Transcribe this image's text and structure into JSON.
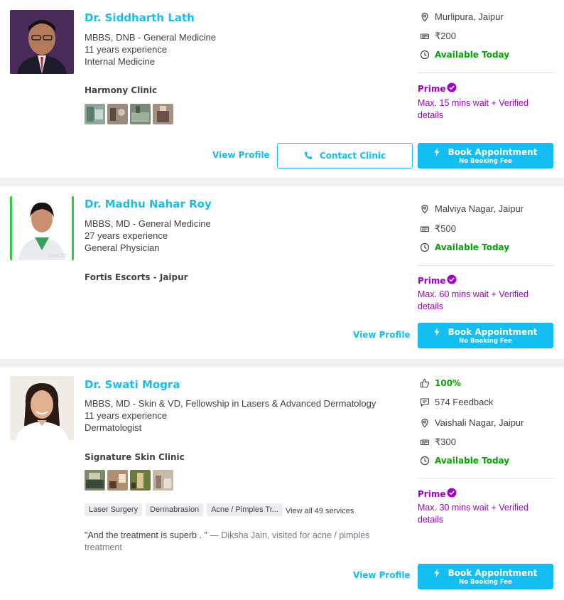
{
  "doctors": [
    {
      "name": "Dr. Siddharth Lath",
      "degree": "MBBS, DNB - General Medicine",
      "experience": "11 years experience",
      "specialty": "Internal Medicine",
      "clinic": "Harmony Clinic",
      "location": "Murlipura, Jaipur",
      "fee": "₹200",
      "availability": "Available Today",
      "prime_label": "Prime",
      "prime_note": "Max. 15 mins wait + Verified details",
      "view_profile": "View Profile",
      "contact_clinic": "Contact Clinic",
      "book": "Book Appointment",
      "book_sub": "No Booking Fee"
    },
    {
      "name": "Dr. Madhu Nahar Roy",
      "degree": "MBBS, MD - General Medicine",
      "experience": "27 years experience",
      "specialty": "General Physician",
      "clinic": "Fortis Escorts - Jaipur",
      "location": "Malviya Nagar, Jaipur",
      "fee": "₹500",
      "availability": "Available Today",
      "prime_label": "Prime",
      "prime_note": "Max. 60 mins wait + Verified details",
      "view_profile": "View Profile",
      "book": "Book Appointment",
      "book_sub": "No Booking Fee",
      "photo_watermark": "practo"
    },
    {
      "name": "Dr. Swati Mogra",
      "degree": "MBBS, MD - Skin & VD, Fellowship in Lasers & Advanced Dermatology",
      "experience": "11 years experience",
      "specialty": "Dermatologist",
      "clinic": "Signature Skin Clinic",
      "rating": "100%",
      "feedback": "574 Feedback",
      "location": "Vaishali Nagar, Jaipur",
      "fee": "₹300",
      "availability": "Available Today",
      "prime_label": "Prime",
      "prime_note": "Max. 30 mins wait + Verified details",
      "services": [
        "Laser Surgery",
        "Dermabrasion",
        "Acne / Pimples Tr..."
      ],
      "view_all_services": "View all 49 services",
      "review_quote": "\"And the treatment is superb . \"",
      "review_attribution": " — Diksha Jain, visited for acne / pimples treatment",
      "view_profile": "View Profile",
      "book": "Book Appointment",
      "book_sub": "No Booking Fee"
    }
  ],
  "colors": {
    "brand": "#14bef0",
    "available": "#01a400",
    "prime": "#a200c8",
    "text": "#414146",
    "background": "#f0f0f5"
  },
  "icons": [
    "location-icon",
    "fee-icon",
    "clock-icon",
    "verified-icon",
    "phone-icon",
    "lightning-icon",
    "thumbs-up-icon",
    "feedback-icon"
  ]
}
